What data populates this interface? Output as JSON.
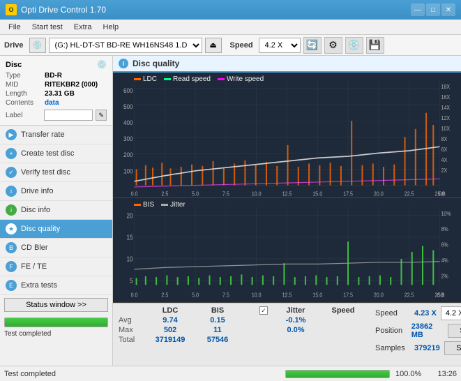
{
  "app": {
    "title": "Opti Drive Control 1.70",
    "icon_label": "O"
  },
  "window_controls": {
    "minimize": "—",
    "maximize": "□",
    "close": "✕"
  },
  "menu": {
    "items": [
      "File",
      "Start test",
      "Extra",
      "Help"
    ]
  },
  "drive_bar": {
    "drive_label": "Drive",
    "drive_value": "(G:)  HL-DT-ST BD-RE  WH16NS48 1.D3",
    "speed_label": "Speed",
    "speed_value": "4.2 X",
    "eject_icon": "⏏"
  },
  "disc": {
    "header": "Disc",
    "type_label": "Type",
    "type_value": "BD-R",
    "mid_label": "MID",
    "mid_value": "RITEKBR2 (000)",
    "length_label": "Length",
    "length_value": "23.31 GB",
    "contents_label": "Contents",
    "contents_value": "data",
    "label_label": "Label",
    "label_value": ""
  },
  "nav": {
    "items": [
      {
        "id": "transfer-rate",
        "label": "Transfer rate",
        "icon": "▶"
      },
      {
        "id": "create-test-disc",
        "label": "Create test disc",
        "icon": "+"
      },
      {
        "id": "verify-test-disc",
        "label": "Verify test disc",
        "icon": "✓"
      },
      {
        "id": "drive-info",
        "label": "Drive info",
        "icon": "i"
      },
      {
        "id": "disc-info",
        "label": "Disc info",
        "icon": "i"
      },
      {
        "id": "disc-quality",
        "label": "Disc quality",
        "icon": "★",
        "active": true
      },
      {
        "id": "cd-bler",
        "label": "CD Bler",
        "icon": "B"
      },
      {
        "id": "fe-te",
        "label": "FE / TE",
        "icon": "F"
      },
      {
        "id": "extra-tests",
        "label": "Extra tests",
        "icon": "E"
      }
    ]
  },
  "status_window_btn": "Status window >>",
  "progress": {
    "value": 100,
    "text": "100.0%",
    "time": "13:26"
  },
  "status_message": "Test completed",
  "disc_quality": {
    "title": "Disc quality",
    "legend_top": {
      "ldc": "LDC",
      "read": "Read speed",
      "write": "Write speed"
    },
    "legend_bottom": {
      "bis": "BIS",
      "jitter": "Jitter"
    },
    "top_chart": {
      "y_max": 600,
      "y_labels": [
        "600",
        "500",
        "400",
        "300",
        "200",
        "100"
      ],
      "y_right_labels": [
        "18X",
        "16X",
        "14X",
        "12X",
        "10X",
        "8X",
        "6X",
        "4X",
        "2X"
      ],
      "x_labels": [
        "0.0",
        "2.5",
        "5.0",
        "7.5",
        "10.0",
        "12.5",
        "15.0",
        "17.5",
        "20.0",
        "22.5",
        "25.0"
      ],
      "x_unit": "GB"
    },
    "bottom_chart": {
      "y_max": 20,
      "y_labels": [
        "20",
        "15",
        "10",
        "5"
      ],
      "y_right_labels": [
        "10%",
        "8%",
        "6%",
        "4%",
        "2%"
      ],
      "x_labels": [
        "0.0",
        "2.5",
        "5.0",
        "7.5",
        "10.0",
        "12.5",
        "15.0",
        "17.5",
        "20.0",
        "22.5",
        "25.0"
      ],
      "x_unit": "GB"
    }
  },
  "stats": {
    "col_headers": [
      "",
      "LDC",
      "BIS",
      "",
      "Jitter",
      "Speed",
      ""
    ],
    "avg_label": "Avg",
    "avg_ldc": "9.74",
    "avg_bis": "0.15",
    "avg_jitter": "-0.1%",
    "max_label": "Max",
    "max_ldc": "502",
    "max_bis": "11",
    "max_jitter": "0.0%",
    "total_label": "Total",
    "total_ldc": "3719149",
    "total_bis": "57546",
    "jitter_checked": true,
    "speed_label": "Speed",
    "speed_value": "4.23 X",
    "speed_select": "4.2 X",
    "position_label": "Position",
    "position_value": "23862 MB",
    "samples_label": "Samples",
    "samples_value": "379219",
    "start_full_btn": "Start full",
    "start_part_btn": "Start part"
  }
}
